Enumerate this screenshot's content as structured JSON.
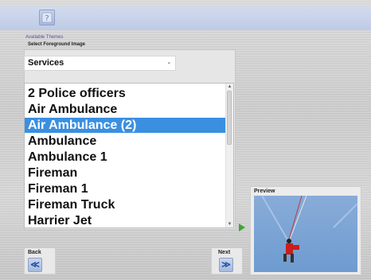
{
  "toolbar": {
    "help_icon": "help-icon"
  },
  "themes": {
    "label": "Available Themes"
  },
  "foreground": {
    "label": "Select Foreground Image",
    "dropdown_value": "Services",
    "dropdown_arrow": "-"
  },
  "list": {
    "items": [
      {
        "label": "2 Police officers",
        "selected": false
      },
      {
        "label": "Air Ambulance",
        "selected": false
      },
      {
        "label": "Air Ambulance (2)",
        "selected": true
      },
      {
        "label": "Ambulance",
        "selected": false
      },
      {
        "label": "Ambulance 1",
        "selected": false
      },
      {
        "label": "Fireman",
        "selected": false
      },
      {
        "label": "Fireman 1",
        "selected": false
      },
      {
        "label": "Fireman Truck",
        "selected": false
      },
      {
        "label": "Harrier Jet",
        "selected": false
      }
    ],
    "scroll_up": "▲",
    "scroll_down": "▼",
    "selected_color": "#3b8fe0"
  },
  "preview": {
    "label": "Preview",
    "image": "rescue-winch-image"
  },
  "nav": {
    "back_label": "Back",
    "back_icon": "≪",
    "next_label": "Next",
    "next_icon": "≫"
  },
  "colors": {
    "accent_arrow": "#3fa535",
    "topbar": "#c7d2ea"
  }
}
